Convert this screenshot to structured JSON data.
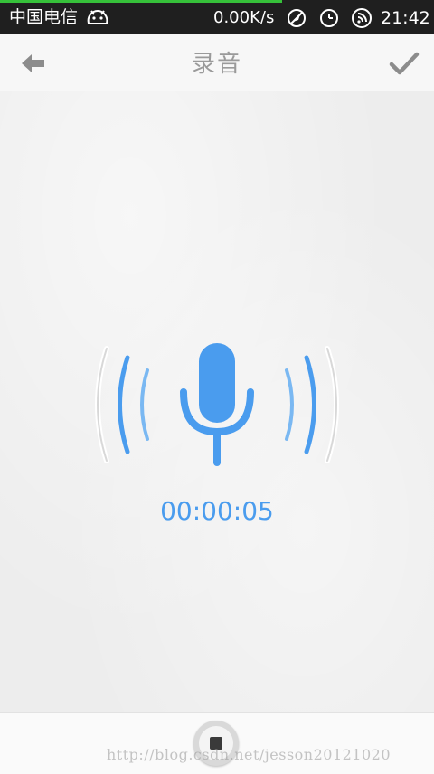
{
  "status_bar": {
    "carrier": "中国电信",
    "net_speed": "0.00K/s",
    "time": "21:42",
    "icons": [
      "android-notification-icon",
      "no-location-icon",
      "alarm-clock-icon",
      "wifi-signal-icon"
    ],
    "background_color": "#1f1f1f",
    "progress_color": "#36c13a"
  },
  "action_bar": {
    "title": "录音",
    "back_icon": "back-arrow-icon",
    "confirm_icon": "checkmark-icon"
  },
  "recorder": {
    "elapsed": "00:00:05",
    "mic_icon": "microphone-icon",
    "accent_color": "#4a9cee"
  },
  "bottom_bar": {
    "stop_icon": "stop-icon",
    "watermark": "http://blog.csdn.net/jesson20121020"
  }
}
